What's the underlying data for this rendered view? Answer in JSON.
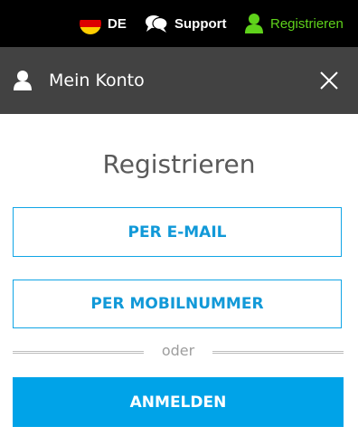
{
  "topbar": {
    "language": {
      "code": "DE",
      "flag": "germany-flag-icon"
    },
    "support": {
      "label": "Support",
      "icon": "chat-bubble-icon"
    },
    "register": {
      "label": "Registrieren",
      "icon": "user-icon",
      "color": "#5fd21b"
    }
  },
  "header": {
    "title": "Mein Konto",
    "icon": "user-icon",
    "close_icon": "close-icon"
  },
  "main": {
    "title": "Registrieren",
    "email_button": "PER E-MAIL",
    "mobile_button": "PER MOBILNUMMER",
    "divider_text": "oder",
    "login_button": "ANMELDEN"
  },
  "colors": {
    "accent": "#00a3e8",
    "topbar_bg": "#000000",
    "header_bg": "#424242",
    "register_green": "#5fd21b"
  }
}
